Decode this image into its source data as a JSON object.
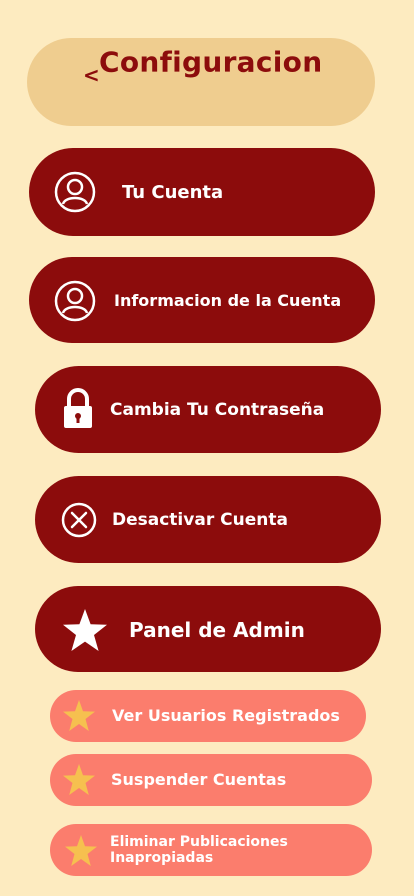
{
  "header": {
    "back_label": "<",
    "title": "Configuracion"
  },
  "menu": {
    "items": [
      {
        "label": "Tu Cuenta",
        "icon": "user-icon"
      },
      {
        "label": "Informacion de la Cuenta",
        "icon": "user-icon"
      },
      {
        "label": "Cambia Tu Contraseña",
        "icon": "lock-icon"
      },
      {
        "label": "Desactivar Cuenta",
        "icon": "close-circle-icon"
      },
      {
        "label": "Panel de Admin",
        "icon": "star-icon"
      }
    ]
  },
  "admin": {
    "items": [
      {
        "label": "Ver Usuarios Registrados",
        "icon": "star-icon"
      },
      {
        "label": "Suspender Cuentas",
        "icon": "star-icon"
      },
      {
        "label_line1": "Eliminar Publicaciones",
        "label_line2": "Inapropiadas",
        "icon": "star-icon"
      }
    ]
  },
  "colors": {
    "background": "#fdebc0",
    "header_bg": "#efcd8f",
    "primary": "#8c0c0c",
    "secondary": "#fb7d6d",
    "star_accent": "#f6c04f",
    "text_on_primary": "#ffffff"
  }
}
